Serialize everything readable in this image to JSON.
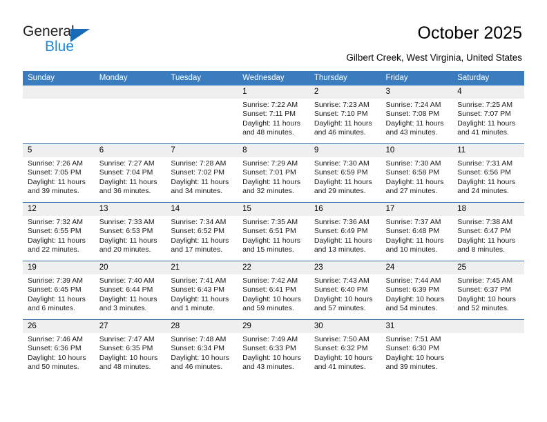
{
  "brand": {
    "name_top": "General",
    "name_bottom": "Blue",
    "triangle_color": "#1a6bb5",
    "blue_text_color": "#1f87d8"
  },
  "header": {
    "title": "October 2025",
    "location": "Gilbert Creek, West Virginia, United States",
    "header_bg_color": "#3a7cbe",
    "header_text_color": "#ffffff",
    "daynum_bg_color": "#efefef"
  },
  "weekdays": [
    "Sunday",
    "Monday",
    "Tuesday",
    "Wednesday",
    "Thursday",
    "Friday",
    "Saturday"
  ],
  "labels": {
    "sunrise": "Sunrise:",
    "sunset": "Sunset:",
    "daylight": "Daylight:"
  },
  "weeks": [
    [
      {
        "day": "",
        "empty": true
      },
      {
        "day": "",
        "empty": true
      },
      {
        "day": "",
        "empty": true
      },
      {
        "day": "1",
        "sunrise": "Sunrise: 7:22 AM",
        "sunset": "Sunset: 7:11 PM",
        "daylight1": "Daylight: 11 hours",
        "daylight2": "and 48 minutes."
      },
      {
        "day": "2",
        "sunrise": "Sunrise: 7:23 AM",
        "sunset": "Sunset: 7:10 PM",
        "daylight1": "Daylight: 11 hours",
        "daylight2": "and 46 minutes."
      },
      {
        "day": "3",
        "sunrise": "Sunrise: 7:24 AM",
        "sunset": "Sunset: 7:08 PM",
        "daylight1": "Daylight: 11 hours",
        "daylight2": "and 43 minutes."
      },
      {
        "day": "4",
        "sunrise": "Sunrise: 7:25 AM",
        "sunset": "Sunset: 7:07 PM",
        "daylight1": "Daylight: 11 hours",
        "daylight2": "and 41 minutes."
      }
    ],
    [
      {
        "day": "5",
        "sunrise": "Sunrise: 7:26 AM",
        "sunset": "Sunset: 7:05 PM",
        "daylight1": "Daylight: 11 hours",
        "daylight2": "and 39 minutes."
      },
      {
        "day": "6",
        "sunrise": "Sunrise: 7:27 AM",
        "sunset": "Sunset: 7:04 PM",
        "daylight1": "Daylight: 11 hours",
        "daylight2": "and 36 minutes."
      },
      {
        "day": "7",
        "sunrise": "Sunrise: 7:28 AM",
        "sunset": "Sunset: 7:02 PM",
        "daylight1": "Daylight: 11 hours",
        "daylight2": "and 34 minutes."
      },
      {
        "day": "8",
        "sunrise": "Sunrise: 7:29 AM",
        "sunset": "Sunset: 7:01 PM",
        "daylight1": "Daylight: 11 hours",
        "daylight2": "and 32 minutes."
      },
      {
        "day": "9",
        "sunrise": "Sunrise: 7:30 AM",
        "sunset": "Sunset: 6:59 PM",
        "daylight1": "Daylight: 11 hours",
        "daylight2": "and 29 minutes."
      },
      {
        "day": "10",
        "sunrise": "Sunrise: 7:30 AM",
        "sunset": "Sunset: 6:58 PM",
        "daylight1": "Daylight: 11 hours",
        "daylight2": "and 27 minutes."
      },
      {
        "day": "11",
        "sunrise": "Sunrise: 7:31 AM",
        "sunset": "Sunset: 6:56 PM",
        "daylight1": "Daylight: 11 hours",
        "daylight2": "and 24 minutes."
      }
    ],
    [
      {
        "day": "12",
        "sunrise": "Sunrise: 7:32 AM",
        "sunset": "Sunset: 6:55 PM",
        "daylight1": "Daylight: 11 hours",
        "daylight2": "and 22 minutes."
      },
      {
        "day": "13",
        "sunrise": "Sunrise: 7:33 AM",
        "sunset": "Sunset: 6:53 PM",
        "daylight1": "Daylight: 11 hours",
        "daylight2": "and 20 minutes."
      },
      {
        "day": "14",
        "sunrise": "Sunrise: 7:34 AM",
        "sunset": "Sunset: 6:52 PM",
        "daylight1": "Daylight: 11 hours",
        "daylight2": "and 17 minutes."
      },
      {
        "day": "15",
        "sunrise": "Sunrise: 7:35 AM",
        "sunset": "Sunset: 6:51 PM",
        "daylight1": "Daylight: 11 hours",
        "daylight2": "and 15 minutes."
      },
      {
        "day": "16",
        "sunrise": "Sunrise: 7:36 AM",
        "sunset": "Sunset: 6:49 PM",
        "daylight1": "Daylight: 11 hours",
        "daylight2": "and 13 minutes."
      },
      {
        "day": "17",
        "sunrise": "Sunrise: 7:37 AM",
        "sunset": "Sunset: 6:48 PM",
        "daylight1": "Daylight: 11 hours",
        "daylight2": "and 10 minutes."
      },
      {
        "day": "18",
        "sunrise": "Sunrise: 7:38 AM",
        "sunset": "Sunset: 6:47 PM",
        "daylight1": "Daylight: 11 hours",
        "daylight2": "and 8 minutes."
      }
    ],
    [
      {
        "day": "19",
        "sunrise": "Sunrise: 7:39 AM",
        "sunset": "Sunset: 6:45 PM",
        "daylight1": "Daylight: 11 hours",
        "daylight2": "and 6 minutes."
      },
      {
        "day": "20",
        "sunrise": "Sunrise: 7:40 AM",
        "sunset": "Sunset: 6:44 PM",
        "daylight1": "Daylight: 11 hours",
        "daylight2": "and 3 minutes."
      },
      {
        "day": "21",
        "sunrise": "Sunrise: 7:41 AM",
        "sunset": "Sunset: 6:43 PM",
        "daylight1": "Daylight: 11 hours",
        "daylight2": "and 1 minute."
      },
      {
        "day": "22",
        "sunrise": "Sunrise: 7:42 AM",
        "sunset": "Sunset: 6:41 PM",
        "daylight1": "Daylight: 10 hours",
        "daylight2": "and 59 minutes."
      },
      {
        "day": "23",
        "sunrise": "Sunrise: 7:43 AM",
        "sunset": "Sunset: 6:40 PM",
        "daylight1": "Daylight: 10 hours",
        "daylight2": "and 57 minutes."
      },
      {
        "day": "24",
        "sunrise": "Sunrise: 7:44 AM",
        "sunset": "Sunset: 6:39 PM",
        "daylight1": "Daylight: 10 hours",
        "daylight2": "and 54 minutes."
      },
      {
        "day": "25",
        "sunrise": "Sunrise: 7:45 AM",
        "sunset": "Sunset: 6:37 PM",
        "daylight1": "Daylight: 10 hours",
        "daylight2": "and 52 minutes."
      }
    ],
    [
      {
        "day": "26",
        "sunrise": "Sunrise: 7:46 AM",
        "sunset": "Sunset: 6:36 PM",
        "daylight1": "Daylight: 10 hours",
        "daylight2": "and 50 minutes."
      },
      {
        "day": "27",
        "sunrise": "Sunrise: 7:47 AM",
        "sunset": "Sunset: 6:35 PM",
        "daylight1": "Daylight: 10 hours",
        "daylight2": "and 48 minutes."
      },
      {
        "day": "28",
        "sunrise": "Sunrise: 7:48 AM",
        "sunset": "Sunset: 6:34 PM",
        "daylight1": "Daylight: 10 hours",
        "daylight2": "and 46 minutes."
      },
      {
        "day": "29",
        "sunrise": "Sunrise: 7:49 AM",
        "sunset": "Sunset: 6:33 PM",
        "daylight1": "Daylight: 10 hours",
        "daylight2": "and 43 minutes."
      },
      {
        "day": "30",
        "sunrise": "Sunrise: 7:50 AM",
        "sunset": "Sunset: 6:32 PM",
        "daylight1": "Daylight: 10 hours",
        "daylight2": "and 41 minutes."
      },
      {
        "day": "31",
        "sunrise": "Sunrise: 7:51 AM",
        "sunset": "Sunset: 6:30 PM",
        "daylight1": "Daylight: 10 hours",
        "daylight2": "and 39 minutes."
      },
      {
        "day": "",
        "empty": true
      }
    ]
  ]
}
